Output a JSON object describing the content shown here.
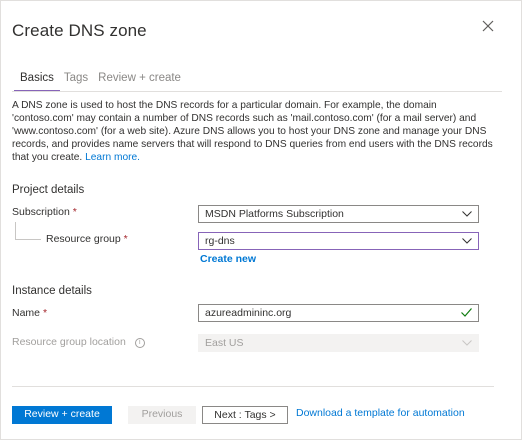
{
  "header": {
    "title": "Create DNS zone",
    "close_icon": "close-icon"
  },
  "tabs": [
    {
      "label": "Basics",
      "active": true
    },
    {
      "label": "Tags",
      "active": false
    },
    {
      "label": "Review + create",
      "active": false
    }
  ],
  "description": {
    "text": "A DNS zone is used to host the DNS records for a particular domain. For example, the domain 'contoso.com' may contain a number of DNS records such as 'mail.contoso.com' (for a mail server) and 'www.contoso.com' (for a web site). Azure DNS allows you to host your DNS zone and manage your DNS records, and provides name servers that will respond to DNS queries from end users with the DNS records that you create.",
    "learn_more": "Learn more."
  },
  "project": {
    "heading": "Project details",
    "subscription_label": "Subscription",
    "subscription_value": "MSDN Platforms Subscription",
    "rg_label": "Resource group",
    "rg_value": "rg-dns",
    "create_new": "Create new"
  },
  "instance": {
    "heading": "Instance details",
    "name_label": "Name",
    "name_value": "azureadmininc.org",
    "location_label": "Resource group location",
    "location_value": "East US"
  },
  "required_marker": "*",
  "footer": {
    "review_create": "Review + create",
    "previous": "Previous",
    "next": "Next : Tags >",
    "download": "Download a template for automation"
  },
  "colors": {
    "accent": "#0078d4",
    "tab_underline": "#8764b8",
    "required": "#a4262c",
    "valid": "#107c10"
  }
}
